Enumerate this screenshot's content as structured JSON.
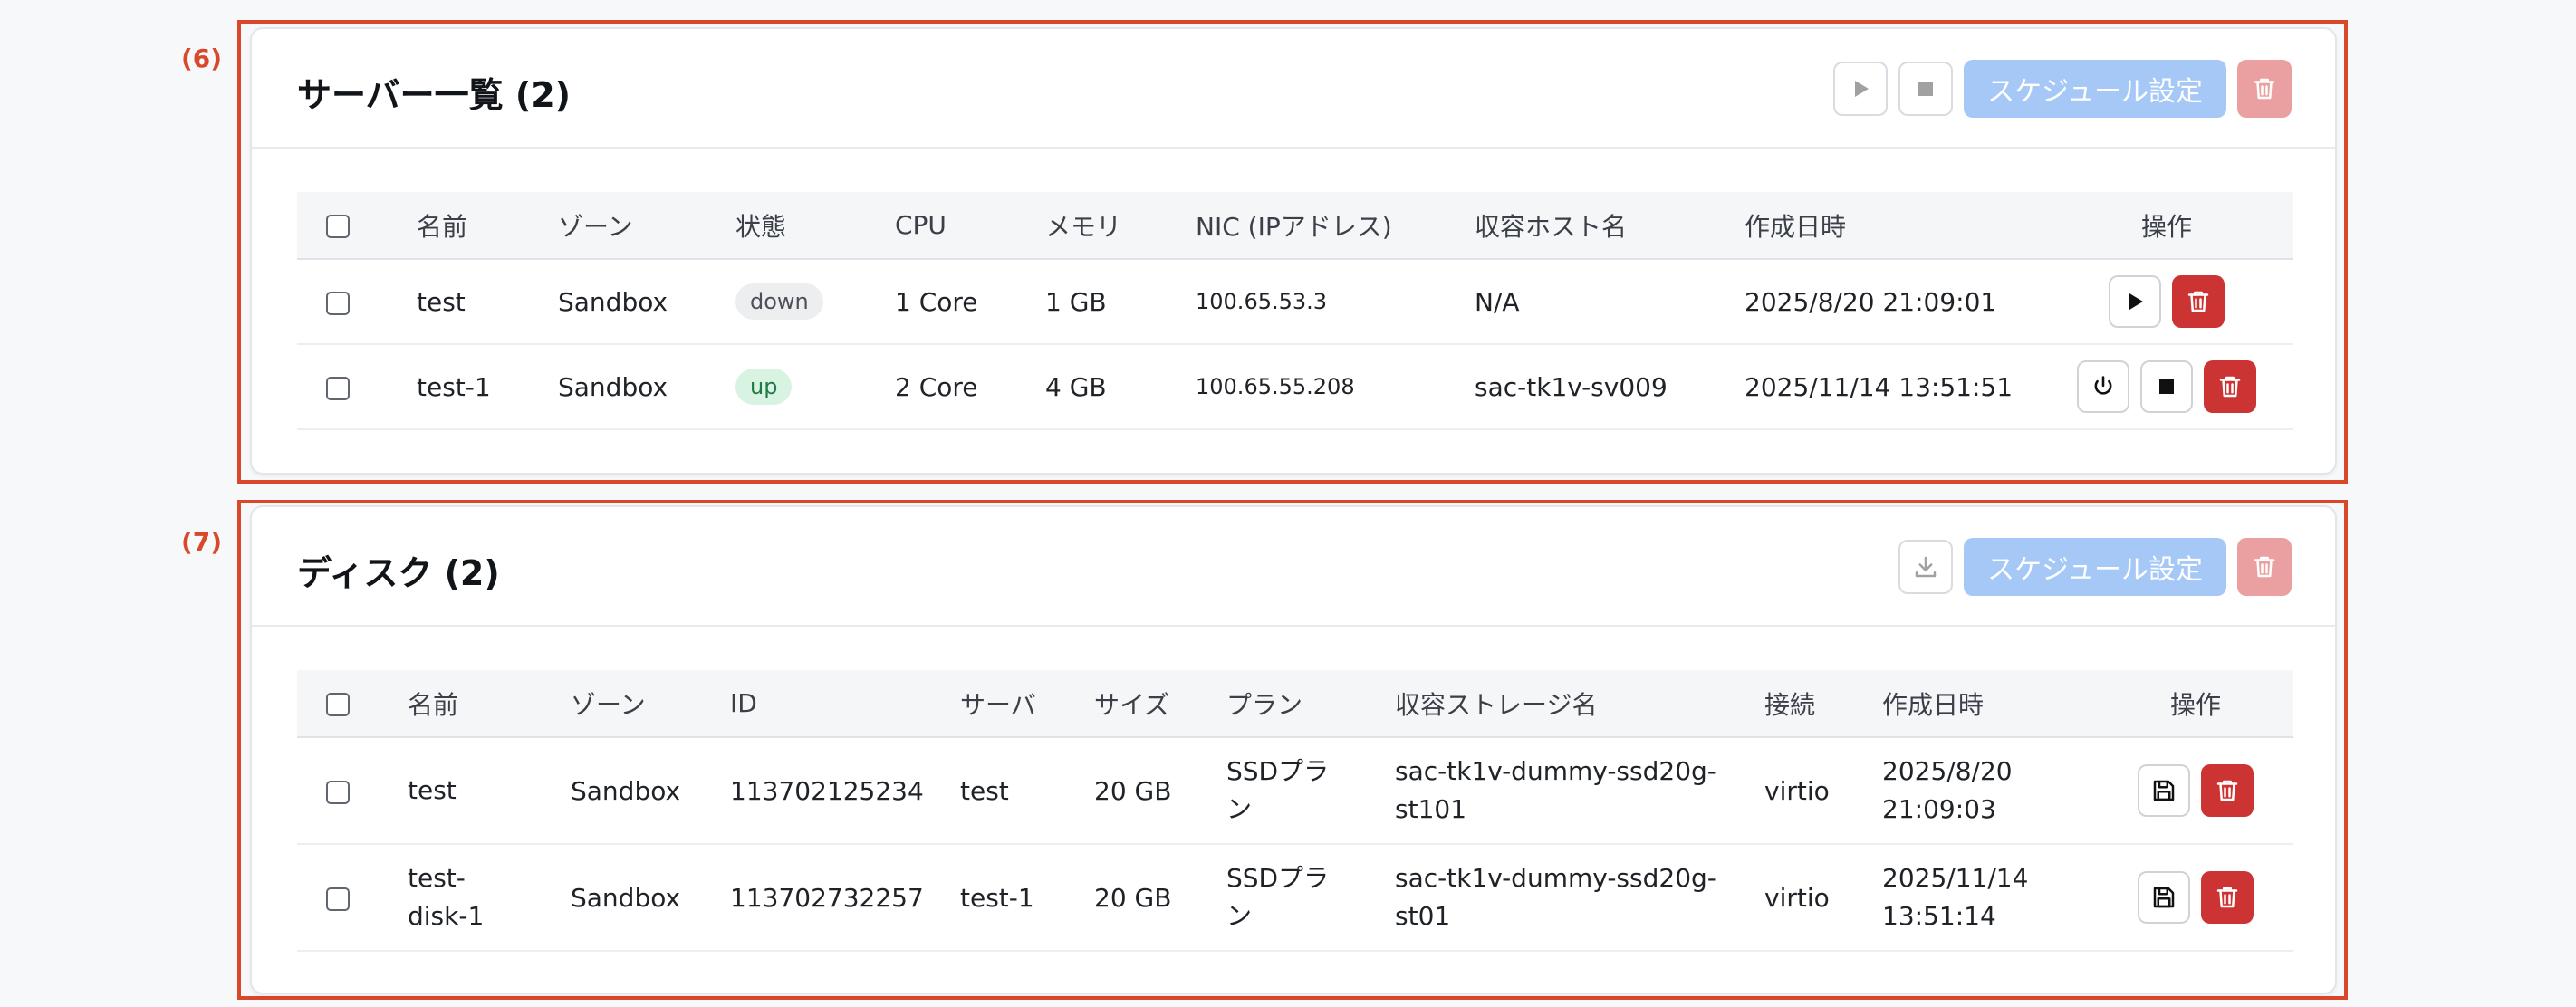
{
  "annotations": {
    "servers_label": "(6)",
    "disks_label": "(7)"
  },
  "colors": {
    "annotation": "#d9482b",
    "primary_disabled": "#a6c8f7",
    "danger": "#cc3333",
    "danger_disabled": "#eaa0a0",
    "badge_up_bg": "#d8f3e2",
    "badge_down_bg": "#eceef0"
  },
  "servers": {
    "title": "サーバー一覧 (2)",
    "schedule_label": "スケジュール設定",
    "header_icons": [
      "play-icon",
      "stop-icon",
      "trash-icon"
    ],
    "columns": [
      "名前",
      "ゾーン",
      "状態",
      "CPU",
      "メモリ",
      "NIC (IPアドレス)",
      "収容ホスト名",
      "作成日時",
      "操作"
    ],
    "rows": [
      {
        "name": "test",
        "zone": "Sandbox",
        "status": "down",
        "cpu": "1 Core",
        "memory": "1 GB",
        "nic": "100.65.53.3",
        "host": "N/A",
        "created": "2025/8/20 21:09:01",
        "action_icons": [
          "play-icon",
          "trash-icon"
        ]
      },
      {
        "name": "test-1",
        "zone": "Sandbox",
        "status": "up",
        "cpu": "2 Core",
        "memory": "4 GB",
        "nic": "100.65.55.208",
        "host": "sac-tk1v-sv009",
        "created": "2025/11/14 13:51:51",
        "action_icons": [
          "power-icon",
          "stop-icon",
          "trash-icon"
        ]
      }
    ]
  },
  "disks": {
    "title": "ディスク (2)",
    "schedule_label": "スケジュール設定",
    "header_icons": [
      "download-icon",
      "trash-icon"
    ],
    "columns": [
      "名前",
      "ゾーン",
      "ID",
      "サーバ",
      "サイズ",
      "プラン",
      "収容ストレージ名",
      "接続",
      "作成日時",
      "操作"
    ],
    "rows": [
      {
        "name_line1": "test",
        "name_line2": "",
        "zone": "Sandbox",
        "id": "113702125234",
        "server": "test",
        "size": "20 GB",
        "plan_line1": "SSDプラ",
        "plan_line2": "ン",
        "storage_line1": "sac-tk1v-dummy-ssd20g-",
        "storage_line2": "st101",
        "connection": "virtio",
        "created_line1": "2025/8/20",
        "created_line2": "21:09:03",
        "action_icons": [
          "save-icon",
          "trash-icon"
        ]
      },
      {
        "name_line1": "test-",
        "name_line2": "disk-1",
        "zone": "Sandbox",
        "id": "113702732257",
        "server": "test-1",
        "size": "20 GB",
        "plan_line1": "SSDプラ",
        "plan_line2": "ン",
        "storage_line1": "sac-tk1v-dummy-ssd20g-",
        "storage_line2": "st01",
        "connection": "virtio",
        "created_line1": "2025/11/14",
        "created_line2": "13:51:14",
        "action_icons": [
          "save-icon",
          "trash-icon"
        ]
      }
    ]
  }
}
